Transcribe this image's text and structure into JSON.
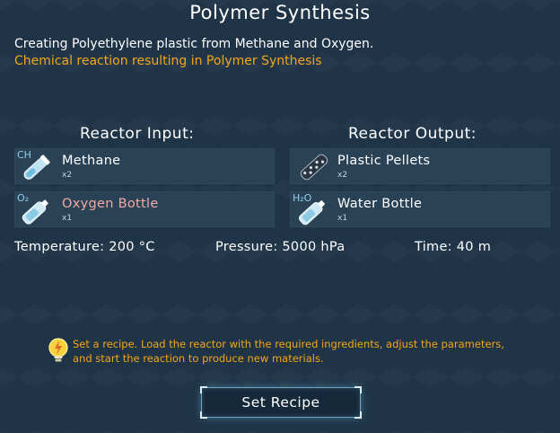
{
  "title": "Polymer Synthesis",
  "description": "Creating Polyethylene plastic from Methane and Oxygen.",
  "subdescription": "Chemical reaction resulting in Polymer Synthesis",
  "input": {
    "heading": "Reactor Input:",
    "items": [
      {
        "name": "Methane",
        "qty": "x2",
        "icon": "methane-tube-icon",
        "formula": "CH"
      },
      {
        "name": "Oxygen Bottle",
        "qty": "x1",
        "icon": "oxygen-bottle-icon",
        "formula": "O₂"
      }
    ]
  },
  "output": {
    "heading": "Reactor Output:",
    "items": [
      {
        "name": "Plastic Pellets",
        "qty": "x2",
        "icon": "plastic-pellets-icon"
      },
      {
        "name": "Water Bottle",
        "qty": "x1",
        "icon": "water-bottle-icon",
        "formula": "H₂O"
      }
    ]
  },
  "stats": {
    "temperature": "Temperature: 200 °C",
    "pressure": "Pressure: 5000 hPa",
    "time": "Time: 40 m"
  },
  "hint": {
    "icon": "lightbulb-icon",
    "text": "Set a recipe. Load the reactor with the required ingredients, adjust the parameters, and start the reaction to produce new materials."
  },
  "button": {
    "label": "Set Recipe"
  },
  "colors": {
    "background": "#1f3447",
    "slot": "#2a4256",
    "accent_orange": "#f4a619",
    "warning_pink": "#f4a9a3",
    "button_glow": "#6fa4c4"
  }
}
